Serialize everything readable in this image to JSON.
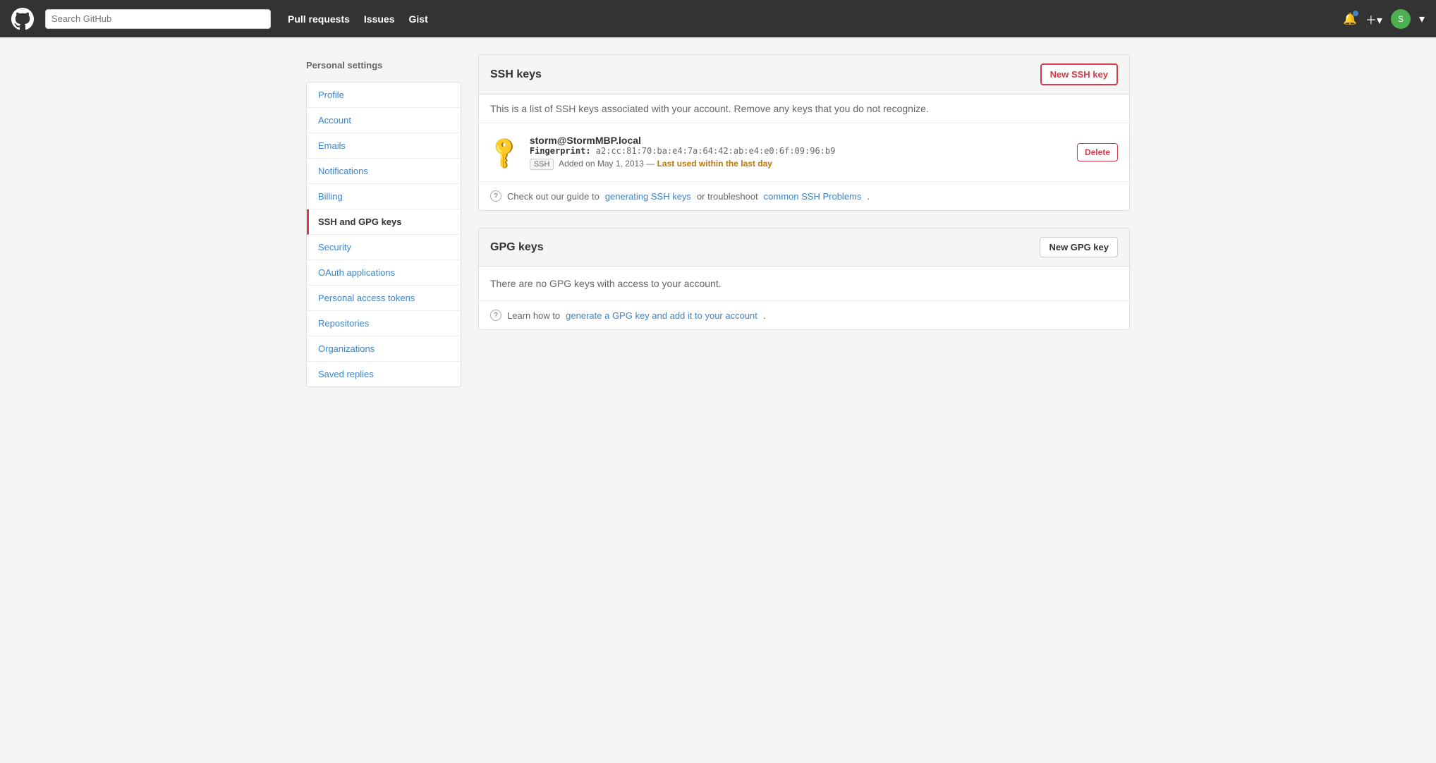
{
  "header": {
    "search_placeholder": "Search GitHub",
    "nav": [
      {
        "label": "Pull requests",
        "href": "#"
      },
      {
        "label": "Issues",
        "href": "#"
      },
      {
        "label": "Gist",
        "href": "#"
      }
    ],
    "plus_label": "+",
    "avatar_initials": "S"
  },
  "sidebar": {
    "title": "Personal settings",
    "items": [
      {
        "label": "Profile",
        "active": false
      },
      {
        "label": "Account",
        "active": false
      },
      {
        "label": "Emails",
        "active": false
      },
      {
        "label": "Notifications",
        "active": false
      },
      {
        "label": "Billing",
        "active": false
      },
      {
        "label": "SSH and GPG keys",
        "active": true
      },
      {
        "label": "Security",
        "active": false
      },
      {
        "label": "OAuth applications",
        "active": false
      },
      {
        "label": "Personal access tokens",
        "active": false
      },
      {
        "label": "Repositories",
        "active": false
      },
      {
        "label": "Organizations",
        "active": false
      },
      {
        "label": "Saved replies",
        "active": false
      }
    ]
  },
  "ssh_section": {
    "title": "SSH keys",
    "new_btn": "New SSH key",
    "description": "This is a list of SSH keys associated with your account. Remove any keys that you do not recognize.",
    "key": {
      "name": "storm@StormMBP.local",
      "fingerprint_label": "Fingerprint:",
      "fingerprint": "a2:cc:81:70:ba:e4:7a:64:42:ab:e4:e0:6f:09:96:b9",
      "badge": "SSH",
      "meta": "Added on May 1, 2013 —",
      "last_used": "Last used within the last day"
    },
    "delete_btn": "Delete",
    "guide_text": "Check out our guide to",
    "guide_link1": "generating SSH keys",
    "guide_mid": "or troubleshoot",
    "guide_link2": "common SSH Problems",
    "guide_end": "."
  },
  "gpg_section": {
    "title": "GPG keys",
    "new_btn": "New GPG key",
    "no_keys": "There are no GPG keys with access to your account.",
    "guide_text": "Learn how to",
    "guide_link": "generate a GPG key and add it to your account",
    "guide_end": "."
  }
}
